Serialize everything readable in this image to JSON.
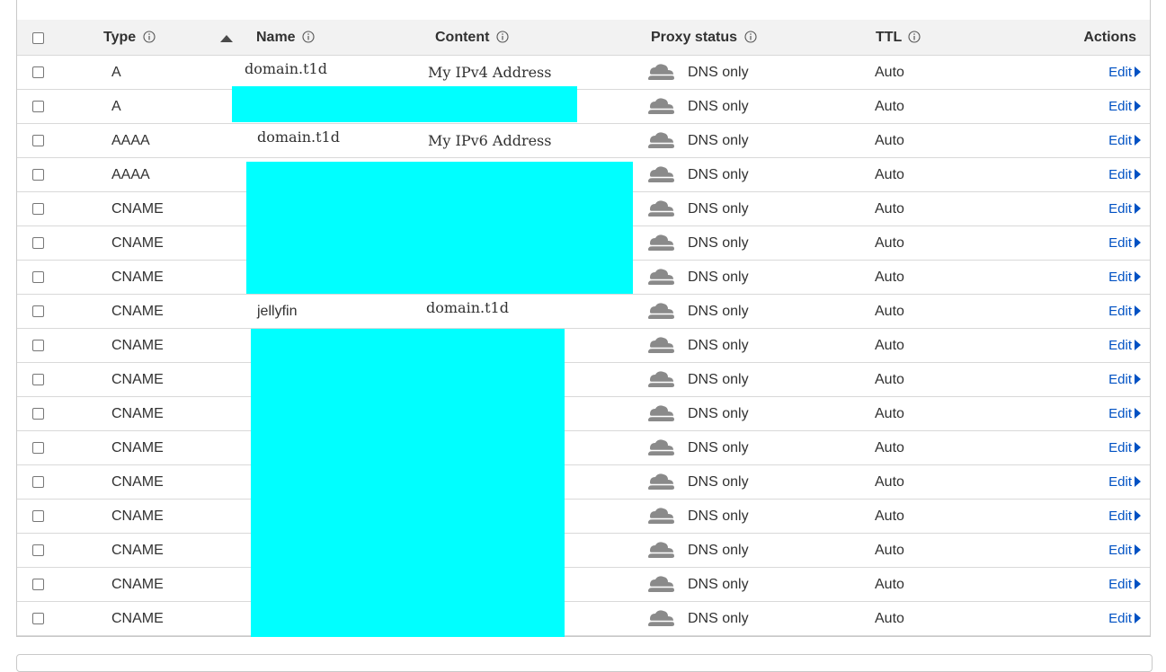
{
  "table": {
    "headers": {
      "type": "Type",
      "name": "Name",
      "content": "Content",
      "proxy_status": "Proxy status",
      "ttl": "TTL",
      "actions": "Actions"
    },
    "rows": [
      {
        "type": "A",
        "name": "domain.t1d",
        "content": "My IPv4 Address",
        "proxy": "DNS only",
        "ttl": "Auto",
        "edit": "Edit"
      },
      {
        "type": "A",
        "name": "",
        "content": "",
        "proxy": "DNS only",
        "ttl": "Auto",
        "edit": "Edit"
      },
      {
        "type": "AAAA",
        "name": "domain.t1d",
        "content": "My IPv6 Address",
        "proxy": "DNS only",
        "ttl": "Auto",
        "edit": "Edit"
      },
      {
        "type": "AAAA",
        "name": "",
        "content": "",
        "proxy": "DNS only",
        "ttl": "Auto",
        "edit": "Edit"
      },
      {
        "type": "CNAME",
        "name": "",
        "content": "",
        "proxy": "DNS only",
        "ttl": "Auto",
        "edit": "Edit"
      },
      {
        "type": "CNAME",
        "name": "",
        "content": "",
        "proxy": "DNS only",
        "ttl": "Auto",
        "edit": "Edit"
      },
      {
        "type": "CNAME",
        "name": "",
        "content": "",
        "proxy": "DNS only",
        "ttl": "Auto",
        "edit": "Edit"
      },
      {
        "type": "CNAME",
        "name": "jellyfin",
        "content": "domain.t1d",
        "proxy": "DNS only",
        "ttl": "Auto",
        "edit": "Edit"
      },
      {
        "type": "CNAME",
        "name": "",
        "content": "",
        "proxy": "DNS only",
        "ttl": "Auto",
        "edit": "Edit"
      },
      {
        "type": "CNAME",
        "name": "",
        "content": "",
        "proxy": "DNS only",
        "ttl": "Auto",
        "edit": "Edit"
      },
      {
        "type": "CNAME",
        "name": "",
        "content": "",
        "proxy": "DNS only",
        "ttl": "Auto",
        "edit": "Edit"
      },
      {
        "type": "CNAME",
        "name": "",
        "content": "",
        "proxy": "DNS only",
        "ttl": "Auto",
        "edit": "Edit"
      },
      {
        "type": "CNAME",
        "name": "",
        "content": "",
        "proxy": "DNS only",
        "ttl": "Auto",
        "edit": "Edit"
      },
      {
        "type": "CNAME",
        "name": "",
        "content": "",
        "proxy": "DNS only",
        "ttl": "Auto",
        "edit": "Edit"
      },
      {
        "type": "CNAME",
        "name": "",
        "content": "",
        "proxy": "DNS only",
        "ttl": "Auto",
        "edit": "Edit"
      },
      {
        "type": "CNAME",
        "name": "",
        "content": "",
        "proxy": "DNS only",
        "ttl": "Auto",
        "edit": "Edit"
      },
      {
        "type": "CNAME",
        "name": "",
        "content": "",
        "proxy": "DNS only",
        "ttl": "Auto",
        "edit": "Edit"
      }
    ]
  },
  "icons": {
    "info": "info-circle-icon",
    "sort": "sort-ascending-icon",
    "proxy": "cloud-dns-only-icon",
    "edit_caret": "caret-right-icon"
  },
  "colors": {
    "link": "#0051c3",
    "redaction": "#00ffff",
    "header_bg": "#f2f2f2",
    "cloud_grey": "#8a8a8a"
  }
}
